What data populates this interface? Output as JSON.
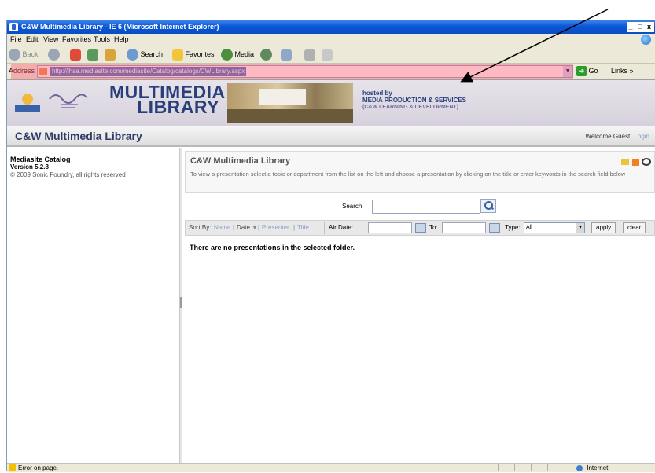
{
  "window": {
    "title": "C&W Multimedia Library - IE 6 (Microsoft Internet Explorer)",
    "controls": "_ □ x"
  },
  "menu": {
    "items": [
      "File",
      "Edit",
      "View",
      "Favorites",
      "Tools",
      "Help"
    ]
  },
  "toolbar": {
    "back": "Back",
    "search": "Search",
    "favorites": "Favorites",
    "media": "Media"
  },
  "address": {
    "label": "Address",
    "url": "http://jhsa.mediasite.com/mediasite/Catalog/catalogs/CWLibrary.aspx",
    "go": "Go",
    "links": "Links"
  },
  "banner": {
    "brand_line1": "MULTIMEDIA",
    "brand_line2": "LIBRARY",
    "hosted_line1": "hosted by",
    "hosted_line2": "MEDIA PRODUCTION & SERVICES",
    "hosted_line3": "(C&W LEARNING & DEVELOPMENT)"
  },
  "header": {
    "title": "C&W Multimedia Library",
    "welcome": "Welcome Guest",
    "login": "Login"
  },
  "sidebar": {
    "catalog_name": "Mediasite Catalog",
    "version": "Version 5.2.8",
    "copyright": "© 2009 Sonic Foundry, all rights reserved"
  },
  "main": {
    "title": "C&W Multimedia Library",
    "description": "To view a presentation select a topic or department from the list on the left and choose a presentation by clicking on the title or enter keywords in the search field below",
    "search_label": "Search",
    "search_value": "",
    "sort_label": "Sort By:",
    "sort_options": [
      "Name",
      "Date",
      "Presenter",
      "Title"
    ],
    "air_date_label": "Air Date:",
    "to_label": "To:",
    "type_label": "Type:",
    "type_value": "All",
    "apply": "apply",
    "clear": "clear",
    "empty_message": "There are no presentations in the selected folder."
  },
  "status": {
    "message": "Error on page.",
    "zone": "Internet"
  },
  "colors": {
    "titlebar": "#0a56d6",
    "highlight": "#ff6478",
    "brand": "#2a3f7a"
  }
}
